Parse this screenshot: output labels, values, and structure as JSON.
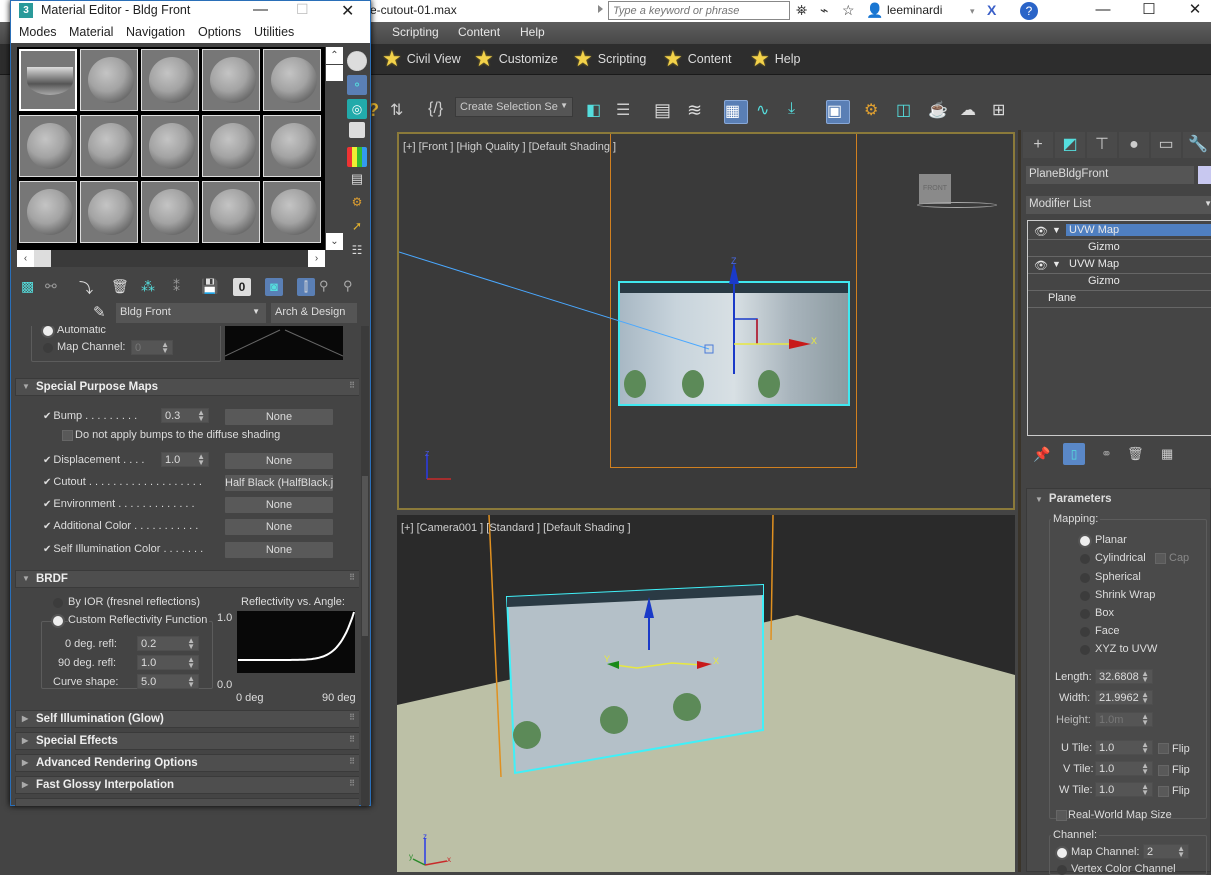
{
  "app": {
    "title_fragment": "e-cutout-01.max",
    "search_placeholder": "Type a keyword or phrase",
    "user": "leeminardi",
    "menu": [
      "Scripting",
      "Content",
      "Help"
    ],
    "quick_items": [
      "Civil View",
      "Customize",
      "Scripting",
      "Content",
      "Help"
    ],
    "selection_set": "Create Selection Se",
    "window_buttons": [
      "minimize",
      "maximize",
      "close"
    ]
  },
  "viewports": {
    "front": {
      "label": "[+] [Front ] [High Quality ] [Default Shading ]",
      "viewcube_face": "FRONT"
    },
    "camera": {
      "label": "[+] [Camera001 ] [Standard ] [Default Shading ]"
    },
    "axes": {
      "x": "X",
      "y": "Y",
      "z": "Z"
    }
  },
  "command_panel": {
    "object_name": "PlaneBldgFront",
    "object_color": "#c8c8f0",
    "modifier_list": "Modifier List",
    "stack": [
      {
        "label": "UVW Map",
        "selected": true,
        "child": "Gizmo"
      },
      {
        "label": "UVW Map",
        "selected": false,
        "child": "Gizmo"
      },
      {
        "label": "Plane"
      }
    ],
    "parameters": {
      "title": "Parameters",
      "mapping_label": "Mapping:",
      "mapping_options": [
        "Planar",
        "Cylindrical",
        "Spherical",
        "Shrink Wrap",
        "Box",
        "Face",
        "XYZ to UVW"
      ],
      "mapping_selected": "Planar",
      "cap_label": "Cap",
      "length_label": "Length:",
      "length": "32.6808",
      "width_label": "Width:",
      "width": "21.9962",
      "height_label": "Height:",
      "height": "1.0m",
      "u_tile_label": "U Tile:",
      "u_tile": "1.0",
      "v_tile_label": "V Tile:",
      "v_tile": "1.0",
      "w_tile_label": "W Tile:",
      "w_tile": "1.0",
      "flip_label": "Flip",
      "real_world": "Real-World Map Size",
      "channel_label": "Channel:",
      "map_channel_label": "Map Channel:",
      "map_channel": "2",
      "vertex_color": "Vertex Color Channel"
    }
  },
  "material_editor": {
    "title": "Material Editor - Bldg Front",
    "menu": [
      "Modes",
      "Material",
      "Navigation",
      "Options",
      "Utilities"
    ],
    "material_name": "Bldg Front",
    "material_type": "Arch & Design",
    "partial": {
      "automatic": "Automatic",
      "map_channel_label": "Map Channel:",
      "map_channel": "0"
    },
    "special_purpose": {
      "title": "Special Purpose Maps",
      "bump_label": "Bump . . . . . . . . .",
      "bump_value": "0.3",
      "bump_map": "None",
      "no_bump_diffuse": "Do not apply bumps to the diffuse shading",
      "disp_label": "Displacement . . . .",
      "disp_value": "1.0",
      "disp_map": "None",
      "cutout_label": "Cutout . . . . . . . . . . . . . . . . . . .",
      "cutout_map": "Half Black (HalfBlack.j",
      "env_label": "Environment . . . . . . . . . . . . .",
      "env_map": "None",
      "addc_label": "Additional Color . . . . . . . . . . .",
      "addc_map": "None",
      "selfc_label": "Self Illumination Color . . . . . . .",
      "selfc_map": "None"
    },
    "brdf": {
      "title": "BRDF",
      "by_ior": "By IOR (fresnel reflections)",
      "custom": "Custom Reflectivity Function",
      "deg0_label": "0 deg. refl:",
      "deg0": "0.2",
      "deg90_label": "90 deg. refl:",
      "deg90": "1.0",
      "curve_label": "Curve shape:",
      "curve": "5.0",
      "graph_title": "Reflectivity vs. Angle:",
      "y_max": "1.0",
      "y_min": "0.0",
      "x_min": "0 deg",
      "x_max": "90 deg"
    },
    "collapsed_rollouts": [
      "Self Illumination (Glow)",
      "Special Effects",
      "Advanced Rendering Options",
      "Fast Glossy Interpolation"
    ]
  }
}
